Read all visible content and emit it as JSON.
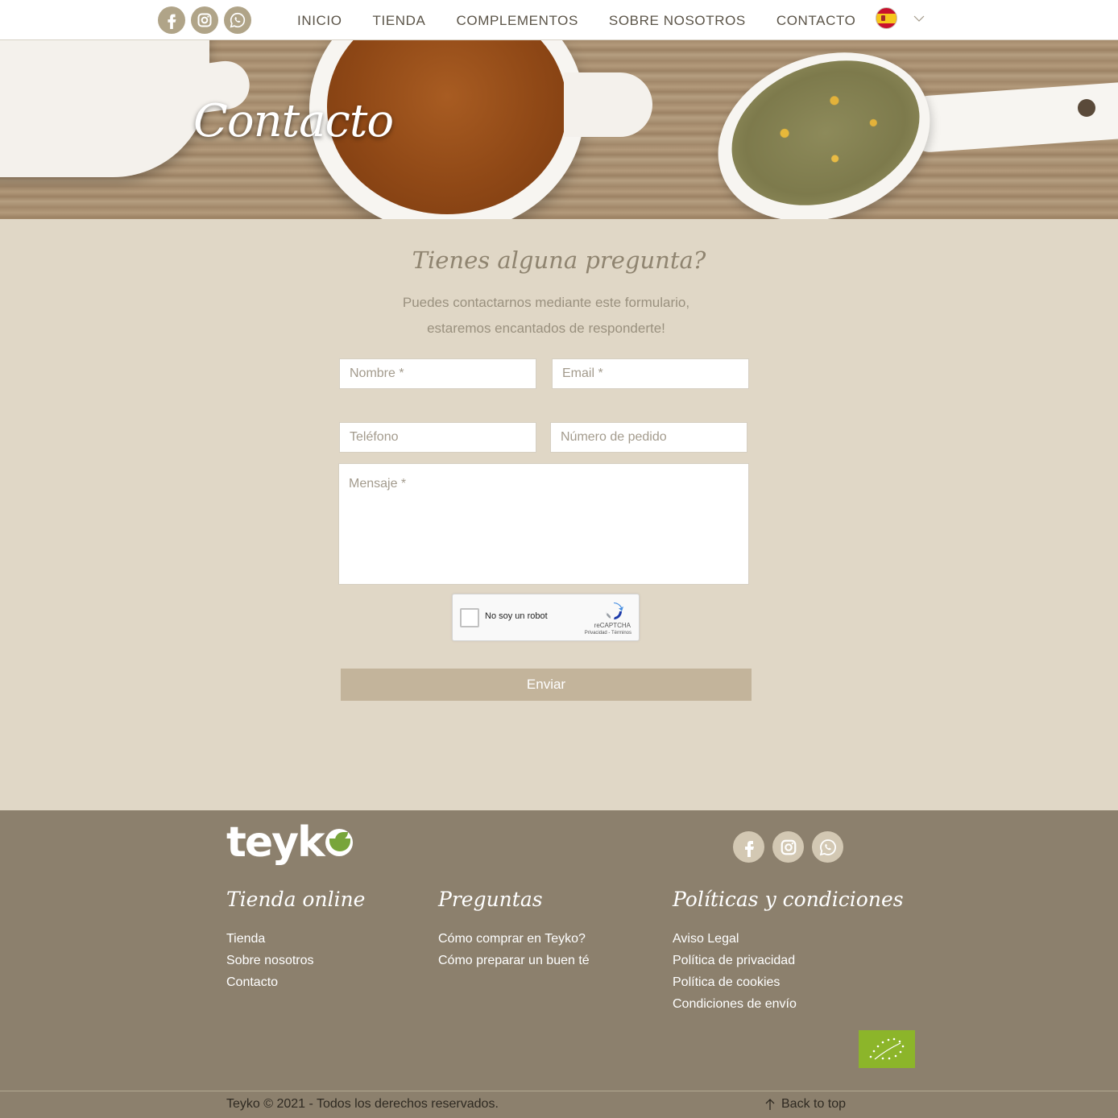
{
  "header": {
    "social_icons": [
      "facebook-icon",
      "instagram-icon",
      "whatsapp-icon"
    ],
    "nav": [
      "INICIO",
      "TIENDA",
      "COMPLEMENTOS",
      "SOBRE NOSOTROS",
      "CONTACTO"
    ],
    "language_flag": "spain-flag-icon"
  },
  "hero": {
    "title": "Contacto"
  },
  "form": {
    "heading": "Tienes alguna pregunta?",
    "subtitle_line1": "Puedes contactarnos mediante este formulario,",
    "subtitle_line2": "estaremos encantados de responderte!",
    "name_placeholder": "Nombre *",
    "email_placeholder": "Email *",
    "phone_placeholder": "Teléfono",
    "order_placeholder": "Número de pedido",
    "message_placeholder": "Mensaje *",
    "captcha_label": "No soy un robot",
    "captcha_brand": "reCAPTCHA",
    "captcha_terms": "Privacidad - Términos",
    "submit_label": "Enviar"
  },
  "footer": {
    "brand": "teyk",
    "columns": [
      {
        "title": "Tienda online",
        "links": [
          "Tienda",
          "Sobre nosotros",
          "Contacto"
        ]
      },
      {
        "title": "Preguntas",
        "links": [
          "Cómo comprar en Teyko?",
          "Cómo preparar un buen té"
        ]
      },
      {
        "title": "Políticas y condiciones",
        "links": [
          "Aviso Legal",
          "Política de privacidad",
          "Política de cookies",
          "Condiciones de envío"
        ]
      }
    ],
    "copyright": "Teyko © 2021 - Todos los derechos reservados.",
    "back_to_top": "Back to top"
  },
  "colors": {
    "page_bg": "#e0d7c6",
    "footer_bg": "#8c806d",
    "accent": "#c3b49b",
    "icon_bg": "#b0a488",
    "eu_logo": "#8cb52a"
  }
}
